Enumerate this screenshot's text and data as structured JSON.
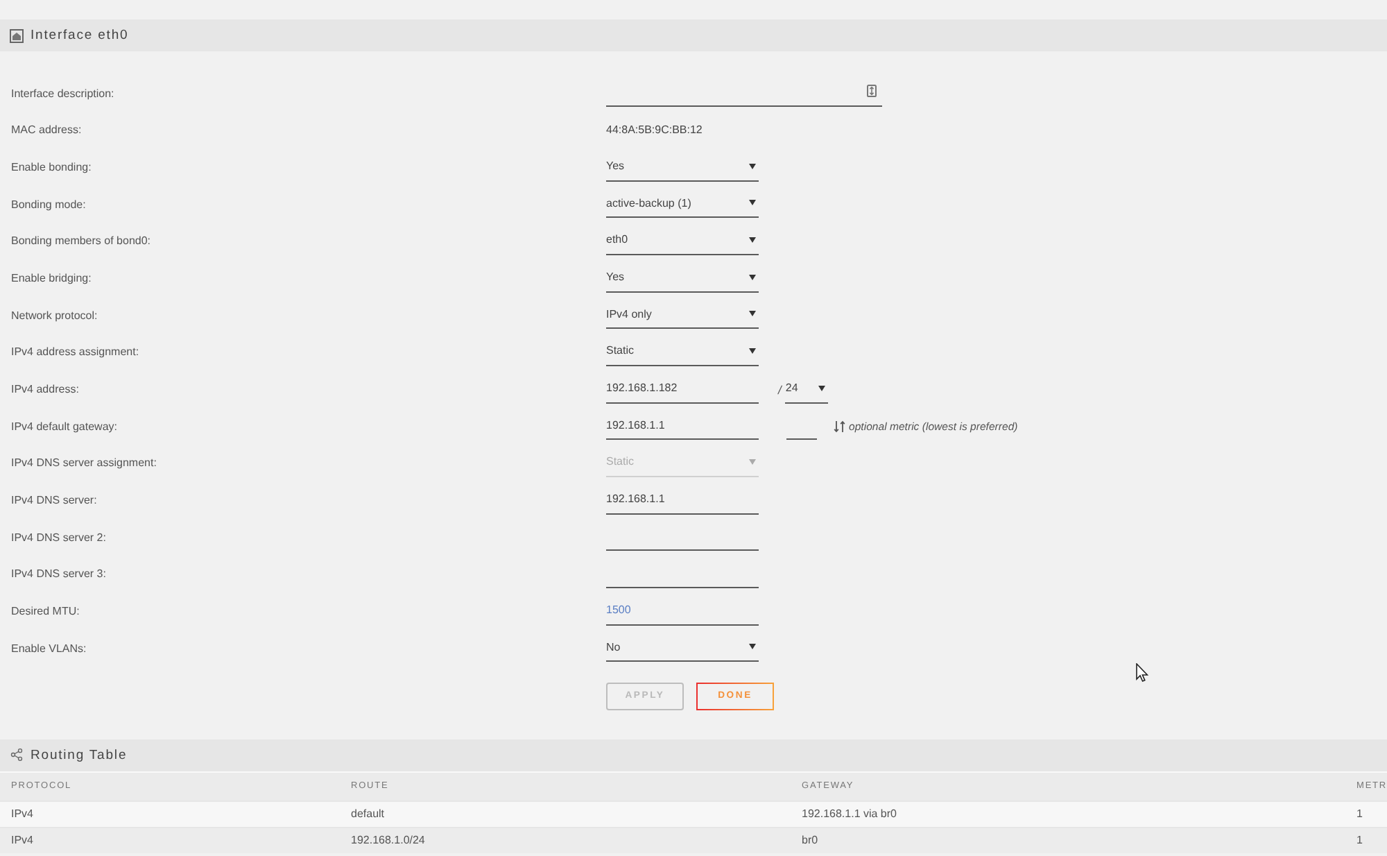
{
  "interface_panel": {
    "title": "Interface eth0",
    "fields": [
      {
        "kind": "expandable_input",
        "label": "Interface description:"
      },
      {
        "kind": "static",
        "label": "MAC address:",
        "value": "44:8A:5B:9C:BB:12"
      },
      {
        "kind": "select",
        "label": "Enable bonding:",
        "value": "Yes",
        "disabled": false
      },
      {
        "kind": "select",
        "label": "Bonding mode:",
        "value": "active-backup (1)",
        "disabled": false
      },
      {
        "kind": "select",
        "label": "Bonding members of bond0:",
        "value": "eth0",
        "disabled": false
      },
      {
        "kind": "select",
        "label": "Enable bridging:",
        "value": "Yes",
        "disabled": false
      },
      {
        "kind": "select",
        "label": "Network protocol:",
        "value": "IPv4 only",
        "disabled": false
      },
      {
        "kind": "select",
        "label": "IPv4 address assignment:",
        "value": "Static",
        "disabled": false
      },
      {
        "kind": "address",
        "label": "IPv4 address:",
        "value": "192.168.1.182",
        "separator": "/",
        "prefix": "24"
      },
      {
        "kind": "gateway",
        "label": "IPv4 default gateway:",
        "value": "192.168.1.1",
        "metric_hint": "optional metric (lowest is preferred)"
      },
      {
        "kind": "select",
        "label": "IPv4 DNS server assignment:",
        "value": "Static",
        "disabled": true
      },
      {
        "kind": "input",
        "label": "IPv4 DNS server:",
        "value": "192.168.1.1"
      },
      {
        "kind": "input",
        "label": "IPv4 DNS server 2:"
      },
      {
        "kind": "input",
        "label": "IPv4 DNS server 3:"
      },
      {
        "kind": "input",
        "label": "Desired MTU:",
        "placeholder": "1500"
      },
      {
        "kind": "select",
        "label": "Enable VLANs:",
        "value": "No",
        "disabled": false
      }
    ],
    "buttons": [
      {
        "label": "APPLY",
        "disabled": true
      },
      {
        "label": "DONE",
        "disabled": false
      }
    ]
  },
  "routing_table": {
    "title": "Routing Table",
    "columns": [
      "PROTOCOL",
      "ROUTE",
      "GATEWAY",
      "METR"
    ],
    "rows": [
      [
        "IPv4",
        "default",
        "192.168.1.1 via br0",
        "1"
      ],
      [
        "IPv4",
        "192.168.1.0/24",
        "br0",
        "1"
      ]
    ]
  }
}
